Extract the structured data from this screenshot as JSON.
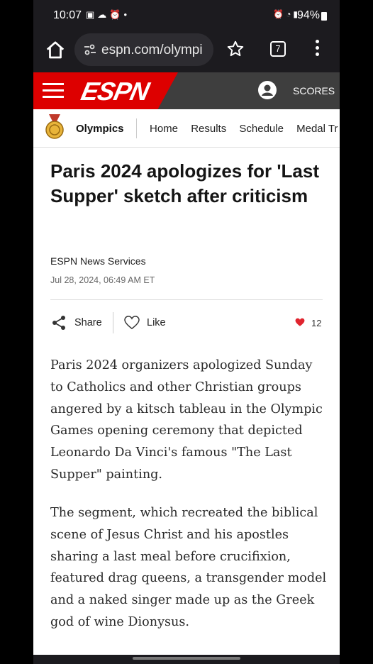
{
  "status_bar": {
    "time": "10:07",
    "left_icons": [
      "image-icon",
      "cloud-icon",
      "alarm-icon",
      "dot"
    ],
    "right_icons": [
      "alarm-icon",
      "wifi-icon",
      "signal-icon"
    ],
    "battery": "94%"
  },
  "browser": {
    "url": "espn.com/olympi",
    "tab_count": "7"
  },
  "espn_header": {
    "logo": "ESPN",
    "scores_label": "SCORES",
    "brand_red": "#dd0000"
  },
  "subnav": {
    "section": "Olympics",
    "links": [
      "Home",
      "Results",
      "Schedule",
      "Medal Tr"
    ]
  },
  "article": {
    "headline": "Paris 2024 apologizes for 'Last Supper' sketch after criticism",
    "byline": "ESPN News Services",
    "date": "Jul 28, 2024, 06:49 AM ET",
    "share_label": "Share",
    "like_label": "Like",
    "like_count": "12",
    "paragraphs": [
      "Paris 2024 organizers apologized Sunday to Catholics and other Christian groups angered by a kitsch tableau in the Olympic Games opening ceremony that depicted Leonardo Da Vinci's famous \"The Last Supper\" painting.",
      "The segment, which recreated the biblical scene of Jesus Christ and his apostles sharing a last meal before crucifixion, featured drag queens, a transgender model and a naked singer made up as the Greek god of wine Dionysus."
    ]
  }
}
